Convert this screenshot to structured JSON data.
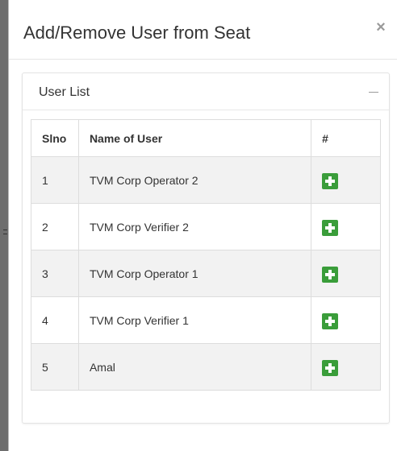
{
  "modal": {
    "title": "Add/Remove User from Seat",
    "close_label": "×"
  },
  "panel": {
    "title": "User List",
    "collapse_icon": "minus-icon"
  },
  "table": {
    "headers": [
      "Slno",
      "Name of User",
      "#"
    ],
    "rows": [
      {
        "slno": "1",
        "name": "TVM Corp Operator 2",
        "action_icon": "plus-square-icon"
      },
      {
        "slno": "2",
        "name": "TVM Corp Verifier 2",
        "action_icon": "plus-square-icon"
      },
      {
        "slno": "3",
        "name": "TVM Corp Operator 1",
        "action_icon": "plus-square-icon"
      },
      {
        "slno": "4",
        "name": "TVM Corp Verifier 1",
        "action_icon": "plus-square-icon"
      },
      {
        "slno": "5",
        "name": "Amal",
        "action_icon": "plus-square-icon"
      }
    ]
  },
  "colors": {
    "add_button": "#3a9d3a",
    "striped_row": "#f2f2f2",
    "border": "#dddddd",
    "text": "#333333"
  }
}
